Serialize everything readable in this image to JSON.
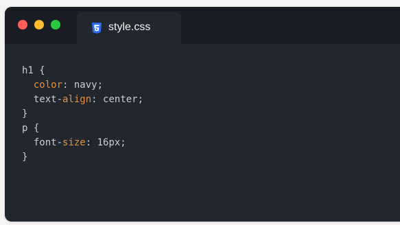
{
  "window": {
    "controls": {
      "close_color": "#ff5f57",
      "minimize_color": "#febc2e",
      "maximize_color": "#28c840"
    },
    "tab": {
      "label": "style.css",
      "icon": "css3-icon",
      "icon_color": "#2d6df6"
    }
  },
  "editor": {
    "lines": [
      {
        "tokens": [
          {
            "text": "h1 {",
            "kind": "plain"
          }
        ]
      },
      {
        "tokens": [
          {
            "text": "  ",
            "kind": "plain"
          },
          {
            "text": "color",
            "kind": "prop"
          },
          {
            "text": ": navy;",
            "kind": "plain"
          }
        ]
      },
      {
        "tokens": [
          {
            "text": "  text-",
            "kind": "plain"
          },
          {
            "text": "align",
            "kind": "prop"
          },
          {
            "text": ": center;",
            "kind": "plain"
          }
        ]
      },
      {
        "tokens": [
          {
            "text": "}",
            "kind": "plain"
          }
        ]
      },
      {
        "tokens": [
          {
            "text": "p {",
            "kind": "plain"
          }
        ]
      },
      {
        "tokens": [
          {
            "text": "  font-",
            "kind": "plain"
          },
          {
            "text": "size",
            "kind": "prop"
          },
          {
            "text": ": 16px;",
            "kind": "plain"
          }
        ]
      },
      {
        "tokens": [
          {
            "text": "}",
            "kind": "plain"
          }
        ]
      }
    ]
  }
}
